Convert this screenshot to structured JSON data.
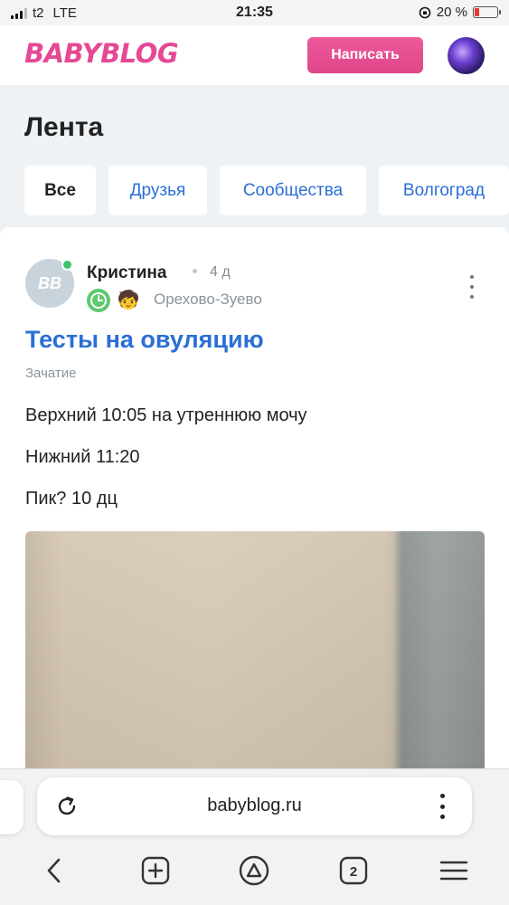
{
  "status_bar": {
    "carrier": "t2",
    "network": "LTE",
    "time": "21:35",
    "battery": "20 %",
    "battery_level": 0.2
  },
  "header": {
    "logo": "BABYBLOG",
    "write_button": "Написать"
  },
  "feed": {
    "title": "Лента",
    "tabs": [
      {
        "label": "Все",
        "active": true
      },
      {
        "label": "Друзья",
        "active": false
      },
      {
        "label": "Сообщества",
        "active": false
      },
      {
        "label": "Волгоград",
        "active": false
      }
    ]
  },
  "post": {
    "avatar_initials": "BB",
    "author": "Кристина",
    "time_ago": "4 д",
    "city": "Орехово-Зуево",
    "title": "Тесты на овуляцию",
    "category": "Зачатие",
    "lines": [
      "Верхний 10:05 на утреннюю мочу",
      "Нижний 11:20",
      "Пик? 10 дц"
    ]
  },
  "browser": {
    "url": "babyblog.ru",
    "tab_count": "2"
  },
  "colors": {
    "brand_pink": "#e54895",
    "link_blue": "#2a6fd6",
    "online_green": "#3fc46a"
  },
  "icons": {
    "reload": "reload-icon",
    "back": "back-icon",
    "new_tab": "plus-square-icon",
    "alice": "alice-icon",
    "tabs": "tabs-icon",
    "menu": "hamburger-icon"
  }
}
